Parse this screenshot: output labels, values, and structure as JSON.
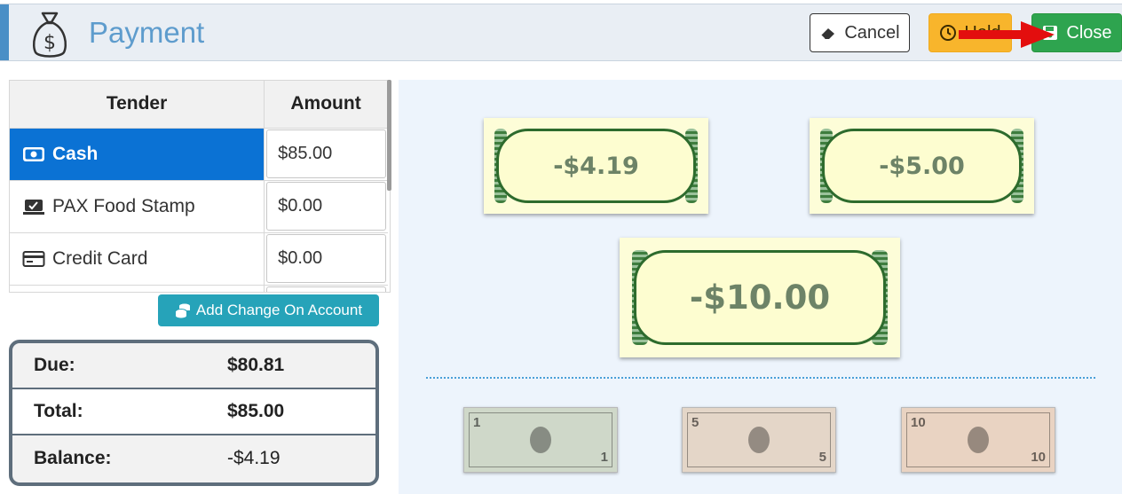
{
  "header": {
    "title": "Payment",
    "buttons": {
      "cancel": "Cancel",
      "hold": "Hold",
      "close": "Close"
    }
  },
  "tender_table": {
    "columns": [
      "Tender",
      "Amount"
    ],
    "rows": [
      {
        "name": "Cash",
        "icon": "cash-icon",
        "amount": "$85.00",
        "active": true
      },
      {
        "name": "PAX Food Stamp",
        "icon": "food-stamp-icon",
        "amount": "$0.00",
        "active": false
      },
      {
        "name": "Credit Card",
        "icon": "credit-card-icon",
        "amount": "$0.00",
        "active": false
      }
    ]
  },
  "add_change_label": "Add Change On Account",
  "summary": {
    "due_label": "Due:",
    "due": "$80.81",
    "total_label": "Total:",
    "total": "$85.00",
    "balance_label": "Balance:",
    "balance": "-$4.19"
  },
  "change_bills": [
    "-$4.19",
    "-$5.00",
    "-$10.00"
  ],
  "quick_notes": [
    {
      "denomination": "1",
      "color": "#cfd8c9"
    },
    {
      "denomination": "5",
      "color": "#e4d6c8"
    },
    {
      "denomination": "10",
      "color": "#e9d3c2"
    }
  ],
  "colors": {
    "accent": "#4a8fc6",
    "active_row": "#0b72d4",
    "close_button": "#2ea44f",
    "hold_button": "#f8b52c",
    "add_change_button": "#26a3b9"
  }
}
